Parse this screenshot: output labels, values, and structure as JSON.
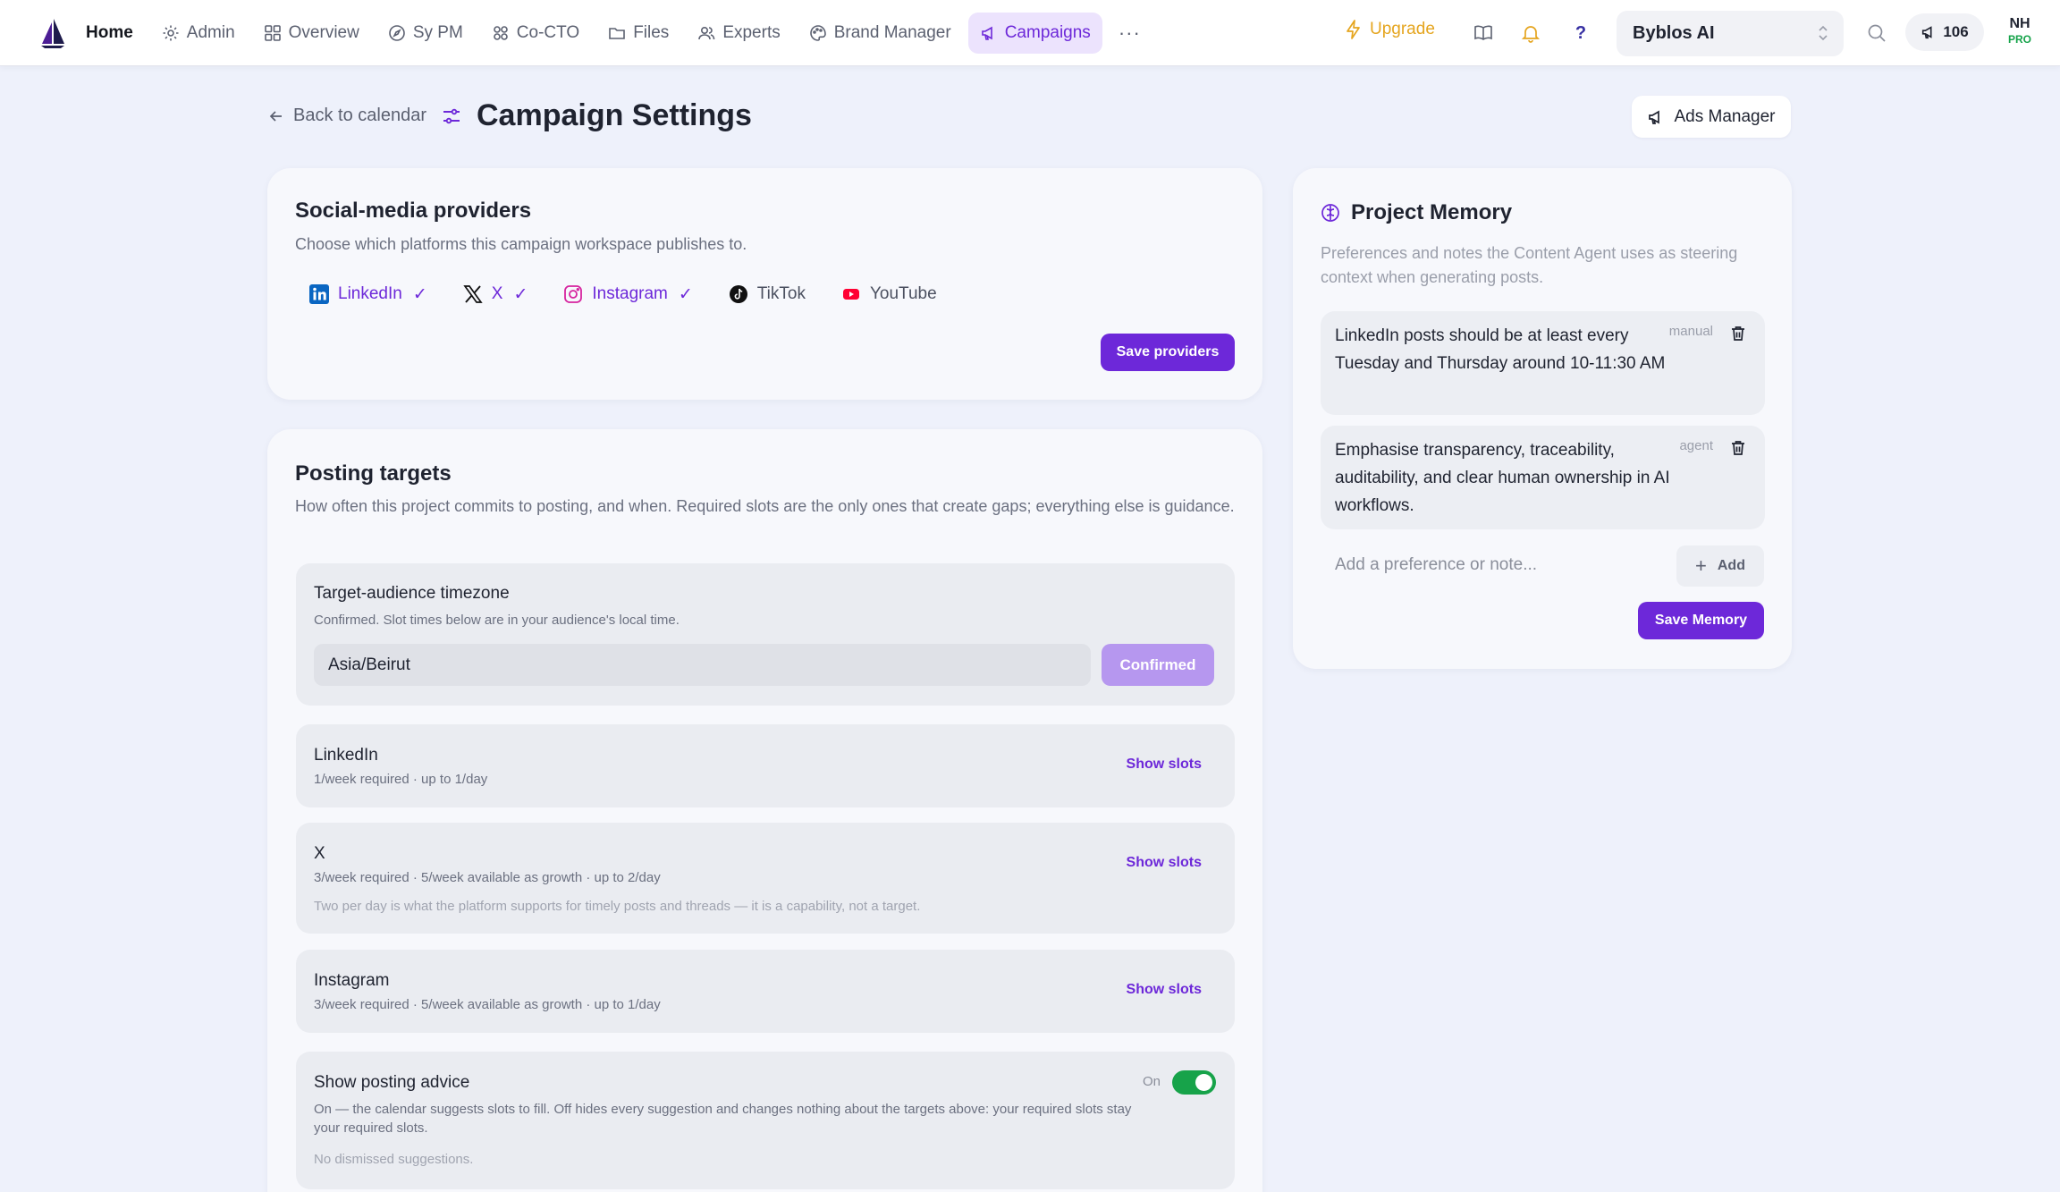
{
  "nav": {
    "items": [
      {
        "label": "Home",
        "icon": "home-logo"
      },
      {
        "label": "Admin",
        "icon": "gear-icon"
      },
      {
        "label": "Overview",
        "icon": "grid-icon"
      },
      {
        "label": "Sy PM",
        "icon": "compass-icon"
      },
      {
        "label": "Co-CTO",
        "icon": "nodes-icon"
      },
      {
        "label": "Files",
        "icon": "folder-icon"
      },
      {
        "label": "Experts",
        "icon": "users-icon"
      },
      {
        "label": "Brand Manager",
        "icon": "palette-icon"
      },
      {
        "label": "Campaigns",
        "icon": "megaphone-icon",
        "active": true
      }
    ],
    "more_label": "···",
    "upgrade_label": "Upgrade",
    "help_label": "?",
    "workspace_name": "Byblos AI",
    "credits": "106",
    "avatar_initials": "NH",
    "avatar_badge": "PRO"
  },
  "header": {
    "back_label": "Back to calendar",
    "title": "Campaign Settings",
    "ads_manager_label": "Ads Manager"
  },
  "providers": {
    "title": "Social-media providers",
    "description": "Choose which platforms this campaign workspace publishes to.",
    "items": [
      {
        "label": "LinkedIn",
        "selected": true,
        "check": "✓"
      },
      {
        "label": "X",
        "selected": true,
        "check": "✓"
      },
      {
        "label": "Instagram",
        "selected": true,
        "check": "✓"
      },
      {
        "label": "TikTok",
        "selected": false
      },
      {
        "label": "YouTube",
        "selected": false
      }
    ],
    "save_label": "Save providers"
  },
  "targets": {
    "title": "Posting targets",
    "description": "How often this project commits to posting, and when. Required slots are the only ones that create gaps; everything else is guidance.",
    "timezone": {
      "title": "Target-audience timezone",
      "subtitle": "Confirmed. Slot times below are in your audience's local time.",
      "value": "Asia/Beirut",
      "button_label": "Confirmed"
    },
    "platforms": [
      {
        "name": "LinkedIn",
        "summary": "1/week required · up to 1/day",
        "note": "",
        "action": "Show slots"
      },
      {
        "name": "X",
        "summary": "3/week required · 5/week available as growth · up to 2/day",
        "note": "Two per day is what the platform supports for timely posts and threads — it is a capability, not a target.",
        "action": "Show slots"
      },
      {
        "name": "Instagram",
        "summary": "3/week required · 5/week available as growth · up to 1/day",
        "note": "",
        "action": "Show slots"
      }
    ],
    "advice": {
      "title": "Show posting advice",
      "toggle_label": "On",
      "toggle_on": true,
      "description": "On — the calendar suggests slots to fill. Off hides every suggestion and changes nothing about the targets above: your required slots stay your required slots.",
      "dismissed": "No dismissed suggestions."
    }
  },
  "memory": {
    "title": "Project Memory",
    "description": "Preferences and notes the Content Agent uses as steering context when generating posts.",
    "notes": [
      {
        "text": "LinkedIn posts should be at least every Tuesday and Thursday around 10-11:30 AM",
        "tag": "manual"
      },
      {
        "text": "Emphasise transparency, traceability, auditability, and clear human ownership in AI workflows.",
        "tag": "agent"
      }
    ],
    "input_placeholder": "Add a preference or note...",
    "add_label": "Add",
    "save_label": "Save Memory"
  },
  "colors": {
    "accent": "#6d28d9",
    "accent_light": "#ece3fd",
    "upgrade": "#e5a51f",
    "toggle_on": "#17a34a",
    "background": "#eef1fb"
  }
}
